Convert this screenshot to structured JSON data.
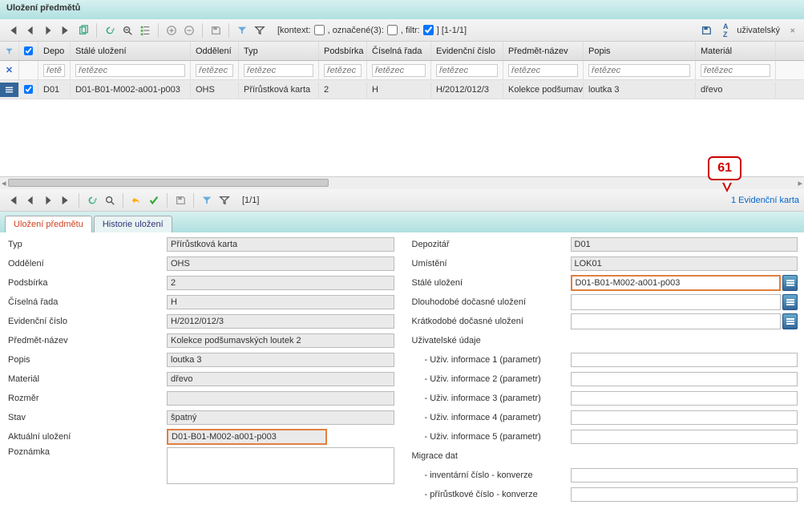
{
  "window": {
    "title": "Uložení předmětů"
  },
  "toolbar1": {
    "kontext_label": "[kontext:",
    "oznacene_label": ", označené(3):",
    "filtr_label": ", filtr:",
    "range": "] [1-1/1]",
    "indicator": "uživatelský"
  },
  "grid": {
    "headers": [
      "",
      "",
      "Depo",
      "Stálé uložení",
      "Oddělení",
      "Typ",
      "Podsbírka",
      "Číselná řada",
      "Evidenční číslo",
      "Předmět-název",
      "Popis",
      "Materiál"
    ],
    "filter_ph": "řetězec",
    "filter_ph_short": "řetě",
    "row": {
      "depo": "D01",
      "stale": "D01-B01-M002-a001-p003",
      "odd": "OHS",
      "typ": "Přírůstková karta",
      "pods": "2",
      "rada": "H",
      "evc": "H/2012/012/3",
      "nazev": "Kolekce podšumav",
      "popis": "loutka 3",
      "mat": "dřevo"
    }
  },
  "toolbar2": {
    "range": "[1/1]",
    "link": "1 Evidenční karta"
  },
  "tabs": {
    "t1": "Uložení předmětu",
    "t2": "Historie uložení"
  },
  "form_left": {
    "typ": {
      "label": "Typ",
      "value": "Přírůstková karta"
    },
    "odd": {
      "label": "Oddělení",
      "value": "OHS"
    },
    "pods": {
      "label": "Podsbírka",
      "value": "2"
    },
    "rada": {
      "label": "Číselná řada",
      "value": "H"
    },
    "evc": {
      "label": "Evidenční číslo",
      "value": "H/2012/012/3"
    },
    "nazev": {
      "label": "Předmět-název",
      "value": "Kolekce podšumavských loutek 2"
    },
    "popis": {
      "label": "Popis",
      "value": "loutka 3"
    },
    "mat": {
      "label": "Materiál",
      "value": "dřevo"
    },
    "rozmer": {
      "label": "Rozměr",
      "value": ""
    },
    "stav": {
      "label": "Stav",
      "value": "špatný"
    },
    "akt": {
      "label": "Aktuální uložení",
      "value": "D01-B01-M002-a001-p003"
    },
    "pozn": {
      "label": "Poznámka",
      "value": ""
    }
  },
  "form_right": {
    "depo": {
      "label": "Depozitář",
      "value": "D01"
    },
    "umist": {
      "label": "Umístění",
      "value": "LOK01"
    },
    "stale": {
      "label": "Stálé uložení",
      "value": "D01-B01-M002-a001-p003"
    },
    "dlouh": {
      "label": "Dlouhodobé dočasné uložení",
      "value": ""
    },
    "krat": {
      "label": "Krátkodobé dočasné uložení",
      "value": ""
    },
    "uziv_hdr": "Uživatelské údaje",
    "u1": {
      "label": "- Uživ. informace 1 (parametr)",
      "value": ""
    },
    "u2": {
      "label": "- Uživ. informace 2 (parametr)",
      "value": ""
    },
    "u3": {
      "label": "- Uživ. informace 3 (parametr)",
      "value": ""
    },
    "u4": {
      "label": "- Uživ. informace 4 (parametr)",
      "value": ""
    },
    "u5": {
      "label": "- Uživ. informace 5 (parametr)",
      "value": ""
    },
    "mig_hdr": "Migrace dat",
    "inv": {
      "label": "- inventární číslo - konverze",
      "value": ""
    },
    "prir": {
      "label": "- přírůstkové číslo - konverze",
      "value": ""
    }
  },
  "callout": "61"
}
